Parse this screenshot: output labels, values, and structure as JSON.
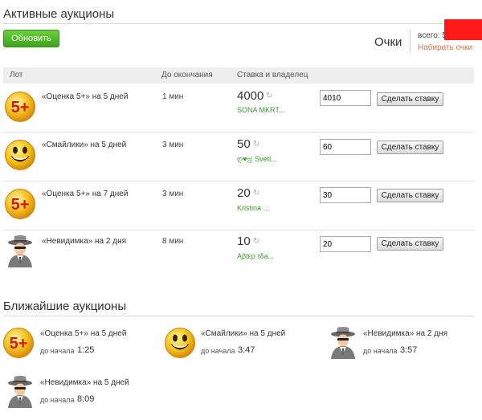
{
  "page": {
    "title": "Активные аукционы",
    "refresh_label": "Обновить",
    "points_label": "Очки",
    "total_label": "всего: 5",
    "earn_link": "Набирать очки"
  },
  "table": {
    "headers": [
      "Лот",
      "До окончания",
      "Ставка и владелец"
    ],
    "rows": [
      {
        "icon": "five-plus-icon",
        "lot": "«Оценка 5+» на 5 дней",
        "time": "1 мин",
        "bid": "4000",
        "owner": "SONA MKRT...",
        "input": "4010",
        "button": "Сделать ставку"
      },
      {
        "icon": "smiley-icon",
        "lot": "«Смайлики» на 5 дней",
        "time": "3 мин",
        "bid": "50",
        "owner": "ღ♥ஐ Svetl...",
        "input": "60",
        "button": "Сделать ставку"
      },
      {
        "icon": "five-plus-icon",
        "lot": "«Оценка 5+» на 7 дней",
        "time": "3 мин",
        "bid": "20",
        "owner": "Kristina ...",
        "input": "30",
        "button": "Сделать ставку"
      },
      {
        "icon": "invisible-spy-icon",
        "lot": "«Невидимка» на 2 дня",
        "time": "8 мин",
        "bid": "10",
        "owner": "Aβtεp τδa...",
        "input": "20",
        "button": "Сделать ставку"
      }
    ]
  },
  "upcoming": {
    "title": "Ближайшие аукционы",
    "start_label": "до начала",
    "items": [
      {
        "icon": "five-plus-icon",
        "name": "«Оценка 5+» на 5 дней",
        "start": "1:25"
      },
      {
        "icon": "smiley-icon",
        "name": "«Смайлики» на 5 дней",
        "start": "3:47"
      },
      {
        "icon": "invisible-spy-icon",
        "name": "«Невидимка» на 2 дня",
        "start": "3:57"
      },
      {
        "icon": "invisible-spy-icon",
        "name": "«Невидимка» на 5 дней",
        "start": "8:09"
      }
    ]
  },
  "colors": {
    "accent_green": "#3ea31c",
    "owner_green": "#3a9b2d",
    "link_orange": "#e0733a",
    "marker_red": "#ff1a1a"
  }
}
